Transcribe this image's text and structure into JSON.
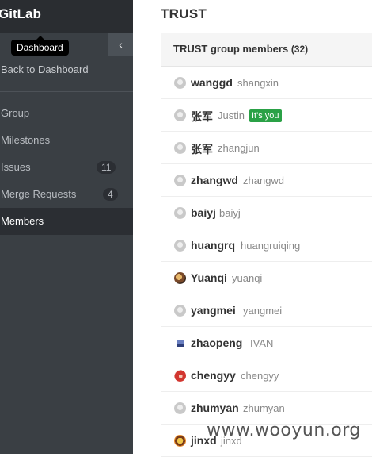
{
  "app": {
    "brand": "GitLab"
  },
  "sidebar": {
    "tooltip": "Dashboard",
    "collapse_icon": "‹",
    "back_link": "Back to Dashboard",
    "items": [
      {
        "label": "Group",
        "badge": ""
      },
      {
        "label": "Milestones",
        "badge": ""
      },
      {
        "label": "Issues",
        "badge": "11"
      },
      {
        "label": "Merge Requests",
        "badge": "4"
      },
      {
        "label": "Members",
        "badge": "",
        "active": true
      }
    ]
  },
  "page": {
    "title": "TRUST"
  },
  "members_panel": {
    "title": "TRUST group members",
    "count": "(32)",
    "its_you_label": "It's you",
    "members": [
      {
        "name": "wanggd",
        "username": "shangxin",
        "avatar": "default"
      },
      {
        "name": "张军",
        "username": "Justin",
        "avatar": "default",
        "is_you": true
      },
      {
        "name": "张军",
        "username": "zhangjun",
        "avatar": "default"
      },
      {
        "name": "zhangwd",
        "username": "zhangwd",
        "avatar": "default"
      },
      {
        "name": "baiyj",
        "username": "baiyj",
        "avatar": "default"
      },
      {
        "name": "huangrq",
        "username": "huangruiqing",
        "avatar": "default"
      },
      {
        "name": "Yuanqi",
        "username": "yuanqi",
        "avatar": "photo"
      },
      {
        "name": "yangmei",
        "username": "yangmei",
        "avatar": "default"
      },
      {
        "name": "zhaopeng",
        "username": "IVAN",
        "avatar": "figure"
      },
      {
        "name": "chengyy",
        "username": "chengyy",
        "avatar": "red"
      },
      {
        "name": "zhumyan",
        "username": "zhumyan",
        "avatar": "default"
      },
      {
        "name": "jinxd",
        "username": "jinxd",
        "avatar": "cartoon"
      }
    ]
  },
  "watermark": "www.wooyun.org"
}
